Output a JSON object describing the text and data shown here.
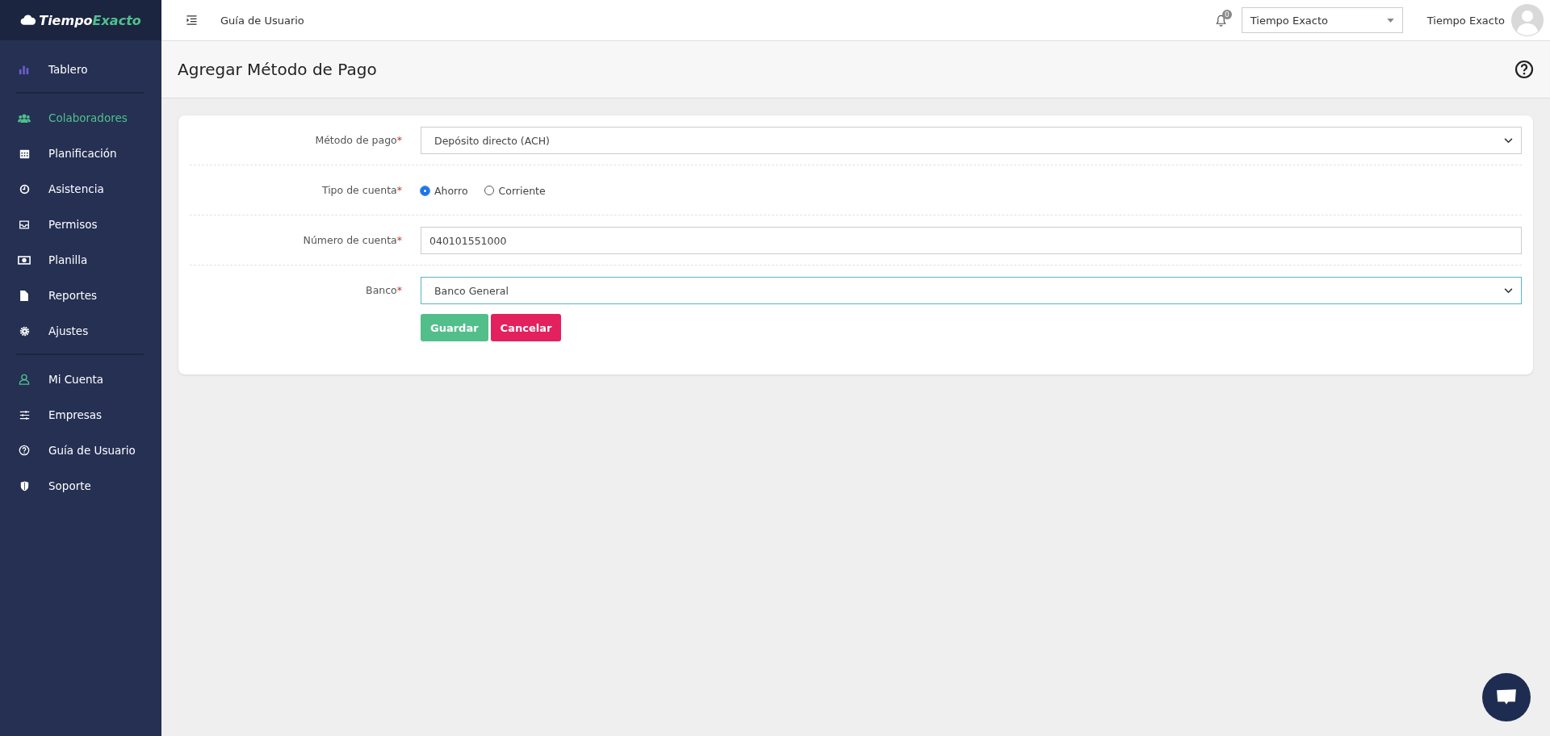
{
  "brand": {
    "part1": "Tiempo",
    "part2": "Exacto"
  },
  "sidebar": {
    "items": [
      {
        "kind": "item",
        "label": "Tablero",
        "selected": false
      },
      {
        "kind": "divider"
      },
      {
        "kind": "item",
        "label": "Colaboradores",
        "selected": true
      },
      {
        "kind": "item",
        "label": "Planificación",
        "selected": false
      },
      {
        "kind": "item",
        "label": "Asistencia",
        "selected": false
      },
      {
        "kind": "item",
        "label": "Permisos",
        "selected": false
      },
      {
        "kind": "item",
        "label": "Planilla",
        "selected": false
      },
      {
        "kind": "item",
        "label": "Reportes",
        "selected": false
      },
      {
        "kind": "item",
        "label": "Ajustes",
        "selected": false
      },
      {
        "kind": "divider"
      },
      {
        "kind": "item",
        "label": "Mi Cuenta",
        "selected": false
      },
      {
        "kind": "item",
        "label": "Empresas",
        "selected": false
      },
      {
        "kind": "item",
        "label": "Guía de Usuario",
        "selected": false
      },
      {
        "kind": "item",
        "label": "Soporte",
        "selected": false
      }
    ]
  },
  "topbar": {
    "link": "Guía de Usuario",
    "notification_count": "0",
    "company_select": "Tiempo Exacto",
    "user_name": "Tiempo Exacto"
  },
  "page": {
    "title": "Agregar Método de Pago"
  },
  "form": {
    "rows": [
      {
        "kind": "select",
        "label": "Método de pago",
        "required_mark": "*",
        "value": "Depósito directo (ACH)",
        "focused": false
      },
      {
        "kind": "radio",
        "label": "Tipo de cuenta",
        "required_mark": "*",
        "options": [
          {
            "label": "Ahorro",
            "selected": true
          },
          {
            "label": "Corriente",
            "selected": false
          }
        ]
      },
      {
        "kind": "text",
        "label": "Número de cuenta",
        "required_mark": "*",
        "value": "040101551000",
        "focused": false
      },
      {
        "kind": "select",
        "label": "Banco",
        "required_mark": "*",
        "value": "Banco General",
        "focused": true
      }
    ],
    "buttons": [
      {
        "kind": "primary",
        "label": "Guardar"
      },
      {
        "kind": "danger",
        "label": "Cancelar"
      }
    ]
  }
}
